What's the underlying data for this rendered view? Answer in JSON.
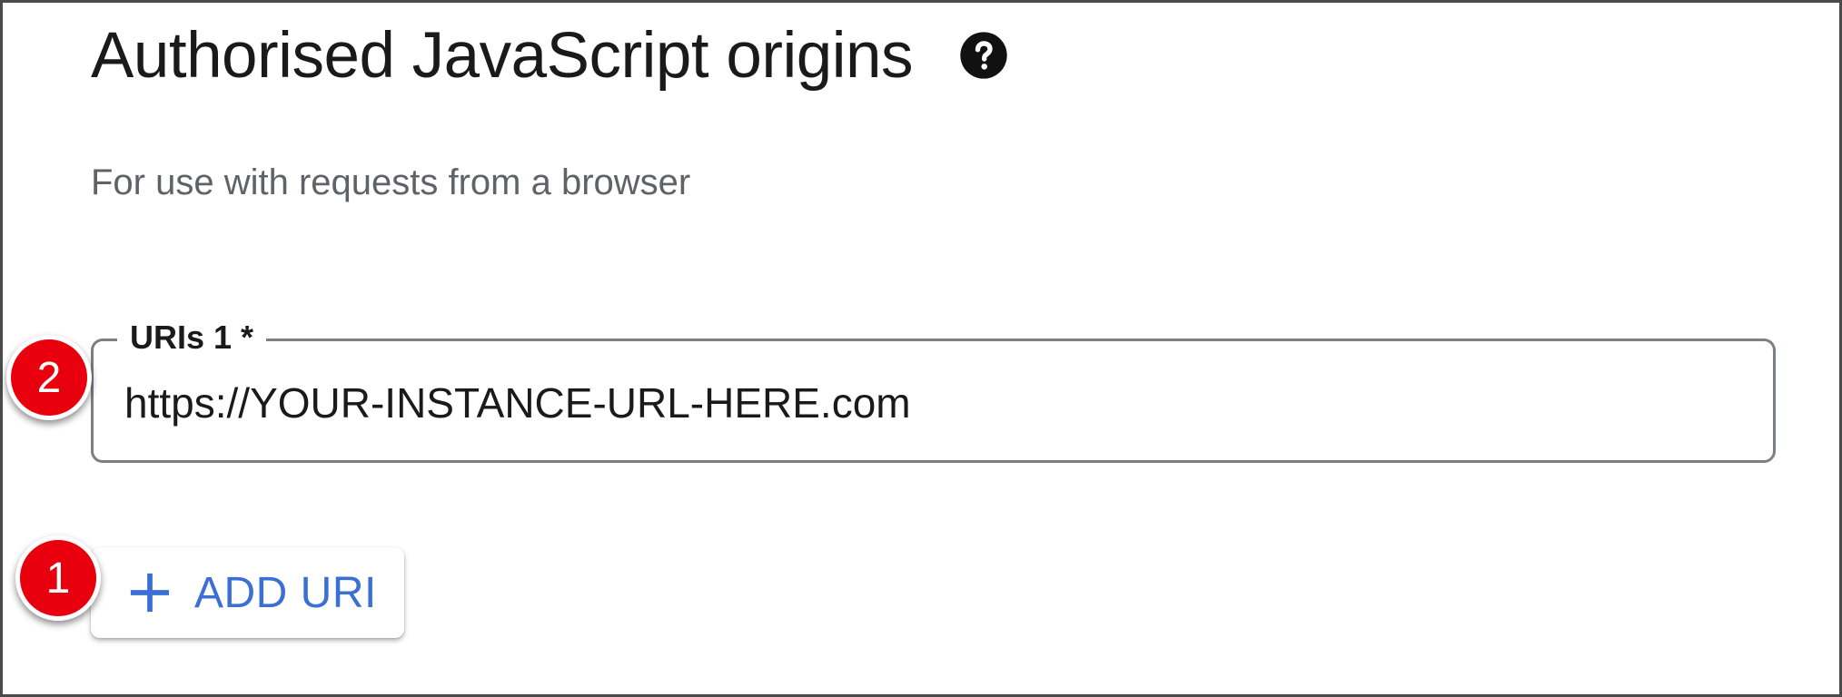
{
  "header": {
    "title": "Authorised JavaScript origins",
    "help_icon": "question-circle-icon",
    "subtitle": "For use with requests from a browser"
  },
  "uri_field": {
    "label": "URIs 1 *",
    "value": "https://YOUR-INSTANCE-URL-HERE.com"
  },
  "add_button": {
    "icon": "plus-icon",
    "label": "ADD URI"
  },
  "markers": [
    {
      "number": "1"
    },
    {
      "number": "2"
    }
  ],
  "colors": {
    "accent": "#3b6fd6",
    "marker": "#e8000f",
    "text": "#1a1a1a",
    "muted": "#5f6368",
    "field_border": "#7b8087"
  }
}
